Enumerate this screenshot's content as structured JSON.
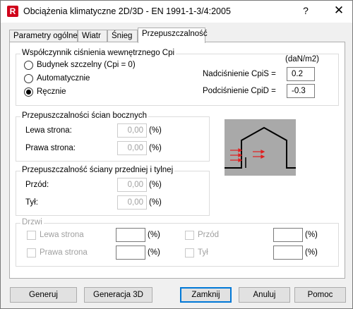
{
  "window": {
    "title": "Obciążenia klimatyczne 2D/3D - EN 1991-1-3/4:2005",
    "app_icon": "R",
    "help": "?",
    "close": "✕"
  },
  "tabs": [
    {
      "label": "Parametry ogólne"
    },
    {
      "label": "Wiatr"
    },
    {
      "label": "Śnieg"
    },
    {
      "label": "Przepuszczalność",
      "active": true
    }
  ],
  "cpi_group": {
    "title": "Współczynnik ciśnienia wewnętrznego Cpi",
    "unit": "(daN/m2)",
    "options": [
      {
        "label": "Budynek szczelny (Cpi = 0)",
        "checked": false
      },
      {
        "label": "Automatycznie",
        "checked": false
      },
      {
        "label": "Ręcznie",
        "checked": true
      }
    ],
    "pressure_label": "Nadciśnienie CpiS =",
    "pressure_value": "0.2",
    "suction_label": "Podciśnienie CpiD =",
    "suction_value": "-0.3"
  },
  "side_walls": {
    "title": "Przepuszczalności ścian bocznych",
    "left_label": "Lewa strona:",
    "left_value": "0,00",
    "right_label": "Prawa strona:",
    "right_value": "0,00",
    "unit": "(%)"
  },
  "front_back": {
    "title": "Przepuszczalność ściany przedniej i tylnej",
    "front_label": "Przód:",
    "front_value": "0,00",
    "back_label": "Tył:",
    "back_value": "0,00",
    "unit": "(%)"
  },
  "doors": {
    "title": "Drzwi",
    "left_label": "Lewa strona",
    "right_label": "Prawa strona",
    "front_label": "Przód",
    "back_label": "Tył",
    "unit": "(%)",
    "left_value": "",
    "right_value": "",
    "front_value": "",
    "back_value": ""
  },
  "buttons": {
    "generate": "Generuj",
    "generate3d": "Generacja 3D",
    "close": "Zamknij",
    "cancel": "Anuluj",
    "help": "Pomoc"
  },
  "colors": {
    "accent": "#0078d7",
    "arrows": "#e02020",
    "illustration_bg": "#a9a9a9"
  }
}
